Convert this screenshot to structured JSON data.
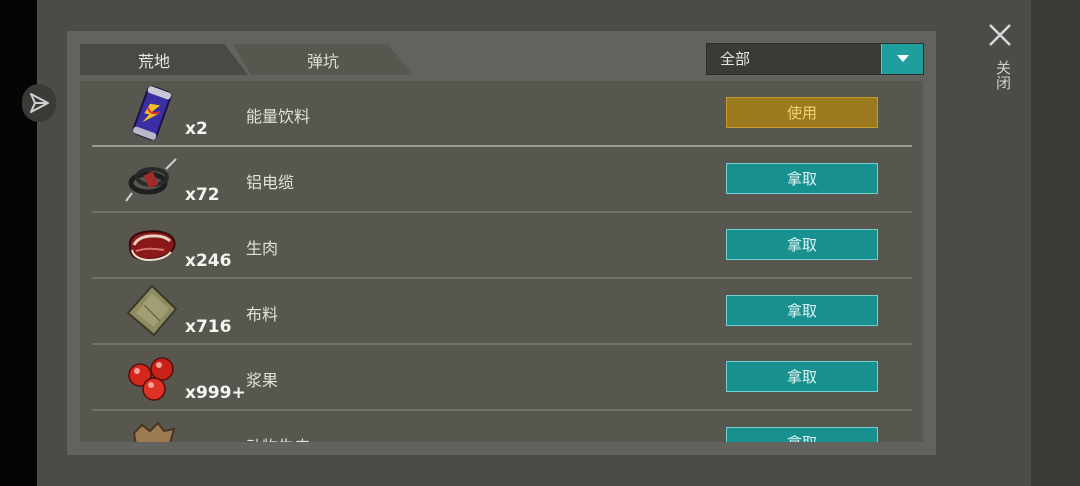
{
  "tabs": [
    {
      "label": "荒地"
    },
    {
      "label": "弹坑"
    }
  ],
  "filter": {
    "selected": "全部"
  },
  "close": {
    "label": "关闭"
  },
  "items": [
    {
      "name": "能量饮料",
      "qty": "x2",
      "action": "使用",
      "icon": "energy-drink-icon"
    },
    {
      "name": "铝电缆",
      "qty": "x72",
      "action": "拿取",
      "icon": "cable-icon"
    },
    {
      "name": "生肉",
      "qty": "x246",
      "action": "拿取",
      "icon": "raw-meat-icon"
    },
    {
      "name": "布料",
      "qty": "x716",
      "action": "拿取",
      "icon": "cloth-icon"
    },
    {
      "name": "浆果",
      "qty": "x999+",
      "action": "拿取",
      "icon": "berries-icon"
    },
    {
      "name": "动物生皮",
      "qty": "",
      "action": "拿取",
      "icon": "animal-hide-icon"
    }
  ],
  "colors": {
    "use_button": "#9a7a1c",
    "take_button": "#18908f",
    "accent": "#1f9e9e"
  }
}
